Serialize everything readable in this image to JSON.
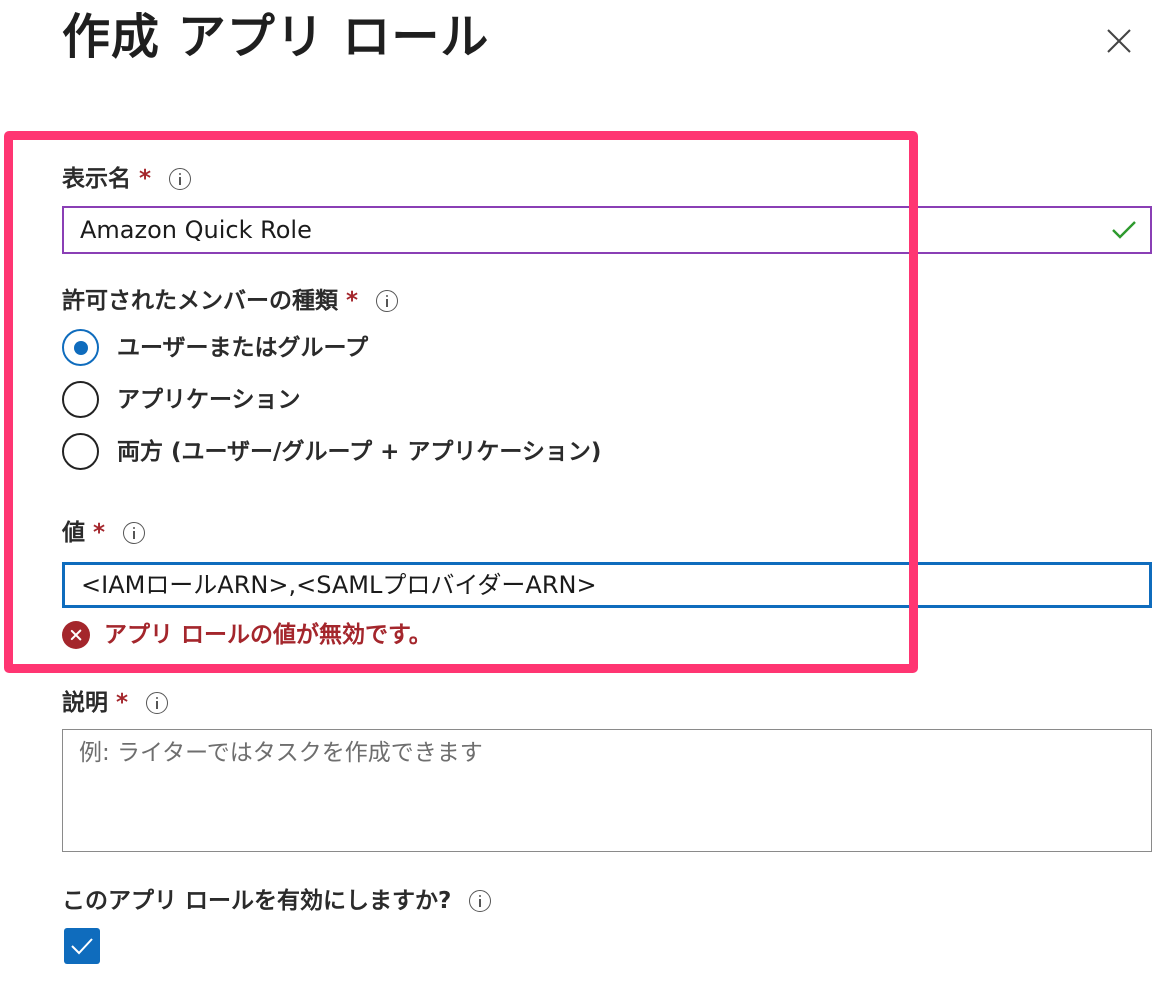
{
  "dialog": {
    "title": "作成 アプリ ロール"
  },
  "display_name": {
    "label": "表示名",
    "required_mark": "*",
    "value": "Amazon Quick Role",
    "valid": true
  },
  "member_types": {
    "label": "許可されたメンバーの種類",
    "required_mark": "*",
    "options": [
      {
        "label": "ユーザーまたはグループ",
        "selected": true
      },
      {
        "label": "アプリケーション",
        "selected": false
      },
      {
        "label": "両方 (ユーザー/グループ + アプリケーション)",
        "selected": false
      }
    ]
  },
  "value_field": {
    "label": "値",
    "required_mark": "*",
    "value": "<IAMロールARN>,<SAMLプロバイダーARN>",
    "error": "アプリ ロールの値が無効です。"
  },
  "description": {
    "label": "説明",
    "required_mark": "*",
    "placeholder": "例: ライターではタスクを作成できます"
  },
  "enable": {
    "label": "このアプリ ロールを有効にしますか?",
    "checked": true
  },
  "colors": {
    "highlight_border": "#ff3572",
    "accent_blue": "#0f6cbd",
    "error_red": "#a4262c",
    "valid_green": "#2e9a2e",
    "name_input_border": "#8a3fb5"
  },
  "icons": {
    "close": "close-icon",
    "info": "info-icon",
    "valid": "checkmark-icon",
    "error": "error-circle-icon",
    "checkbox": "checkbox-checked-icon"
  }
}
